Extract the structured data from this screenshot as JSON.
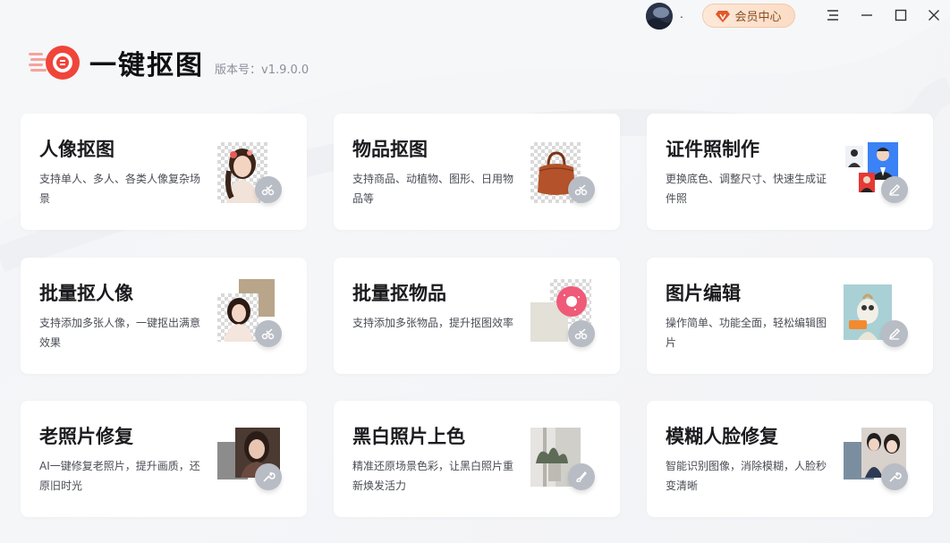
{
  "header": {
    "username": ".",
    "vip_label": "会员中心"
  },
  "app": {
    "title": "一键抠图",
    "version": "版本号：v1.9.0.0"
  },
  "cards": [
    {
      "title": "人像抠图",
      "desc": "支持单人、多人、各类人像复杂场景",
      "icon": "scissors-icon"
    },
    {
      "title": "物品抠图",
      "desc": "支持商品、动植物、图形、日用物品等",
      "icon": "scissors-icon"
    },
    {
      "title": "证件照制作",
      "desc": "更换底色、调整尺寸、快速生成证件照",
      "icon": "pencil-icon"
    },
    {
      "title": "批量抠人像",
      "desc": "支持添加多张人像，一键抠出满意效果",
      "icon": "scissors-icon"
    },
    {
      "title": "批量抠物品",
      "desc": "支持添加多张物品，提升抠图效率",
      "icon": "scissors-icon"
    },
    {
      "title": "图片编辑",
      "desc": "操作简单、功能全面，轻松编辑图片",
      "icon": "pencil-icon"
    },
    {
      "title": "老照片修复",
      "desc": "AI一键修复老照片，提升画质，还原旧时光",
      "icon": "wrench-icon"
    },
    {
      "title": "黑白照片上色",
      "desc": "精准还原场景色彩，让黑白照片重新焕发活力",
      "icon": "brush-icon"
    },
    {
      "title": "模糊人脸修复",
      "desc": "智能识别图像，消除模糊，人脸秒变清晰",
      "icon": "wrench-icon"
    }
  ],
  "colors": {
    "brand": "#f0453a",
    "vip_text": "#8a4b1f",
    "badge": "#b8bcc4"
  }
}
